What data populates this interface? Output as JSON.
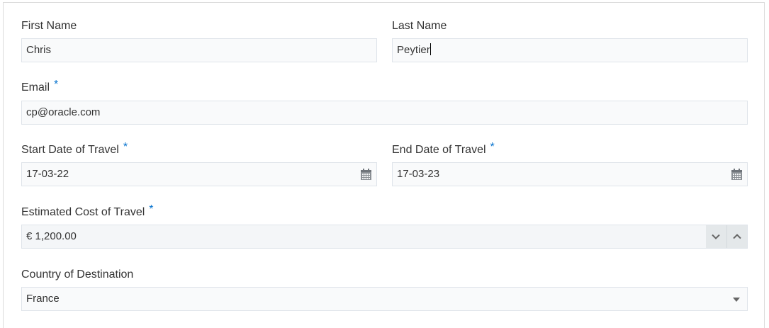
{
  "form": {
    "first_name": {
      "label": "First Name",
      "value": "Chris"
    },
    "last_name": {
      "label": "Last Name",
      "value": "Peytier"
    },
    "email": {
      "label": "Email",
      "required_marker": "*",
      "value": "cp@oracle.com"
    },
    "start_date": {
      "label": "Start Date of Travel",
      "required_marker": "*",
      "value": "17-03-22",
      "icon": "calendar-icon"
    },
    "end_date": {
      "label": "End Date of Travel",
      "required_marker": "*",
      "value": "17-03-23",
      "icon": "calendar-icon"
    },
    "estimated_cost": {
      "label": "Estimated Cost of Travel",
      "required_marker": "*",
      "value": "€ 1,200.00",
      "decrement_icon": "chevron-down-icon",
      "increment_icon": "chevron-up-icon"
    },
    "country": {
      "label": "Country of Destination",
      "value": "France",
      "icon": "dropdown-arrow-icon"
    }
  },
  "colors": {
    "required_marker": "#0572ce",
    "input_background": "#f9fafb",
    "input_border": "#dfe4ea",
    "stepper_background": "#e4e8ea"
  }
}
